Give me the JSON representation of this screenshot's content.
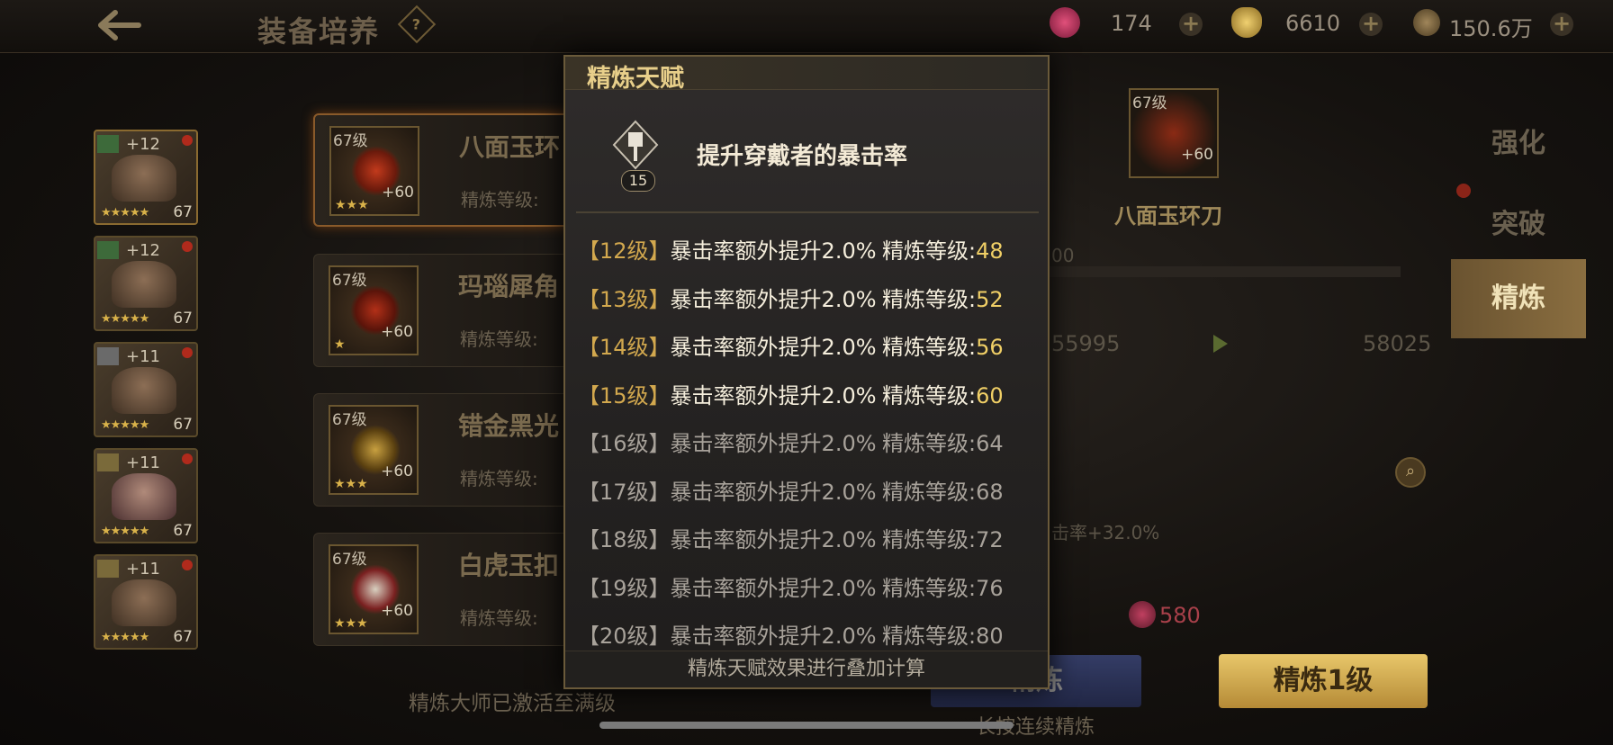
{
  "header": {
    "title": "装备培养",
    "help": "?",
    "resources": [
      {
        "icon": "feather-icon",
        "value": "174"
      },
      {
        "icon": "gold-ingot-icon",
        "value": "6610"
      },
      {
        "icon": "coin-icon",
        "value": "150.6万"
      }
    ]
  },
  "heroes": [
    {
      "plus": "+12",
      "level": "67",
      "stars": "★★★★★"
    },
    {
      "plus": "+12",
      "level": "67",
      "stars": "★★★★★"
    },
    {
      "plus": "+11",
      "level": "67",
      "stars": "★★★★★"
    },
    {
      "plus": "+11",
      "level": "67",
      "stars": "★★★★★"
    },
    {
      "plus": "+11",
      "level": "67",
      "stars": "★★★★★"
    }
  ],
  "equipment": [
    {
      "level": "67级",
      "plus": "+60",
      "name": "八面玉环",
      "sub": "精炼等级:",
      "stars": "★★★"
    },
    {
      "level": "67级",
      "plus": "+60",
      "name": "玛瑙犀角",
      "sub": "精炼等级:",
      "stars": "★"
    },
    {
      "level": "67级",
      "plus": "+60",
      "name": "错金黑光",
      "sub": "精炼等级:",
      "stars": "★★★"
    },
    {
      "level": "67级",
      "plus": "+60",
      "name": "白虎玉扣",
      "sub": "精炼等级:",
      "stars": "★★★"
    }
  ],
  "master_text": "精炼大师已激活至满级",
  "detail": {
    "item_level": "67级",
    "item_plus": "+60",
    "item_name": "八面玉环刀",
    "partial_val": "00",
    "stat_from": "55995",
    "stat_to": "58025",
    "crit_text": "击率+32.0%",
    "cost": "580"
  },
  "tabs": [
    "强化",
    "突破",
    "精炼"
  ],
  "buttons": {
    "refine": "精炼",
    "refine1": "精炼1级",
    "long_press": "长按连续精炼"
  },
  "popup": {
    "title": "精炼天赋",
    "badge": "15",
    "description": "提升穿戴者的暴击率",
    "rows": [
      {
        "level": "12级",
        "effect": "暴击率额外提升2.0%",
        "req_label": "精炼等级:",
        "req_value": "48",
        "active": true
      },
      {
        "level": "13级",
        "effect": "暴击率额外提升2.0%",
        "req_label": "精炼等级:",
        "req_value": "52",
        "active": true
      },
      {
        "level": "14级",
        "effect": "暴击率额外提升2.0%",
        "req_label": "精炼等级:",
        "req_value": "56",
        "active": true
      },
      {
        "level": "15级",
        "effect": "暴击率额外提升2.0%",
        "req_label": "精炼等级:",
        "req_value": "60",
        "active": true
      },
      {
        "level": "16级",
        "effect": "暴击率额外提升2.0%",
        "req_label": "精炼等级:",
        "req_value": "64",
        "active": false
      },
      {
        "level": "17级",
        "effect": "暴击率额外提升2.0%",
        "req_label": "精炼等级:",
        "req_value": "68",
        "active": false
      },
      {
        "level": "18级",
        "effect": "暴击率额外提升2.0%",
        "req_label": "精炼等级:",
        "req_value": "72",
        "active": false
      },
      {
        "level": "19级",
        "effect": "暴击率额外提升2.0%",
        "req_label": "精炼等级:",
        "req_value": "76",
        "active": false
      },
      {
        "level": "20级",
        "effect": "暴击率额外提升2.0%",
        "req_label": "精炼等级:",
        "req_value": "80",
        "active": false
      }
    ],
    "footer": "精炼天赋效果进行叠加计算"
  }
}
